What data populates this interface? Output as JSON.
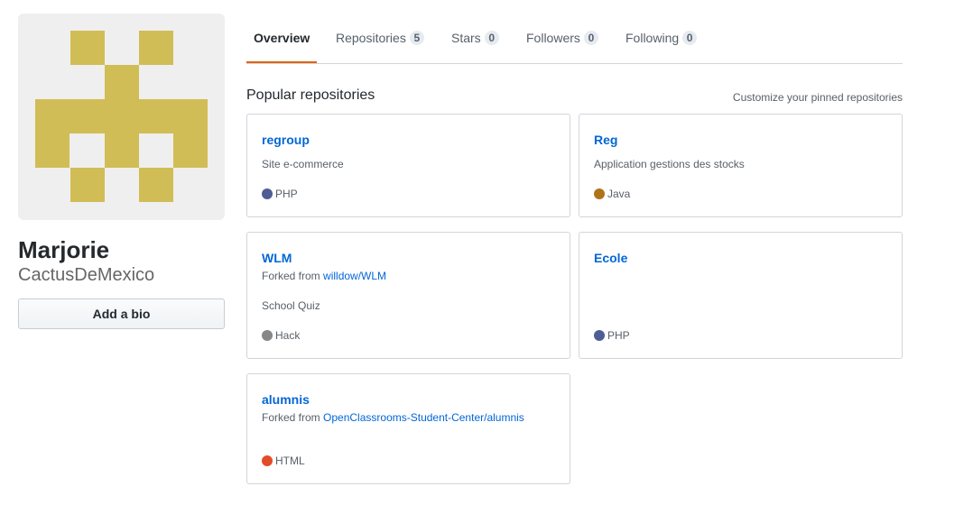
{
  "profile": {
    "display_name": "Marjorie",
    "username": "CactusDeMexico",
    "bio_button_label": "Add a bio",
    "avatar_icon": "identicon",
    "avatar_color": "#d1bd55",
    "avatar_background": "#efefef"
  },
  "tabs": [
    {
      "label": "Overview",
      "count": null,
      "selected": true
    },
    {
      "label": "Repositories",
      "count": "5",
      "selected": false
    },
    {
      "label": "Stars",
      "count": "0",
      "selected": false
    },
    {
      "label": "Followers",
      "count": "0",
      "selected": false
    },
    {
      "label": "Following",
      "count": "0",
      "selected": false
    }
  ],
  "pinned": {
    "title": "Popular repositories",
    "customize_label": "Customize your pinned repositories",
    "repos": [
      {
        "name": "regroup",
        "forked_prefix": "",
        "forked_from": "",
        "description": "Site e-commerce",
        "language": "PHP",
        "language_color": "#4F5D95"
      },
      {
        "name": "Reg",
        "forked_prefix": "",
        "forked_from": "",
        "description": "Application gestions des stocks",
        "language": "Java",
        "language_color": "#b07219"
      },
      {
        "name": "WLM",
        "forked_prefix": "Forked from",
        "forked_from": "willdow/WLM",
        "description": "School Quiz",
        "language": "Hack",
        "language_color": "#878787"
      },
      {
        "name": "Ecole",
        "forked_prefix": "",
        "forked_from": "",
        "description": "",
        "language": "PHP",
        "language_color": "#4F5D95"
      },
      {
        "name": "alumnis",
        "forked_prefix": "Forked from",
        "forked_from": "OpenClassrooms-Student-Center/alumnis",
        "description": "",
        "language": "HTML",
        "language_color": "#e34c26"
      }
    ]
  },
  "colors": {
    "link": "#0366d6",
    "selected_tab_underline": "#e36209",
    "muted_text": "#586069"
  }
}
